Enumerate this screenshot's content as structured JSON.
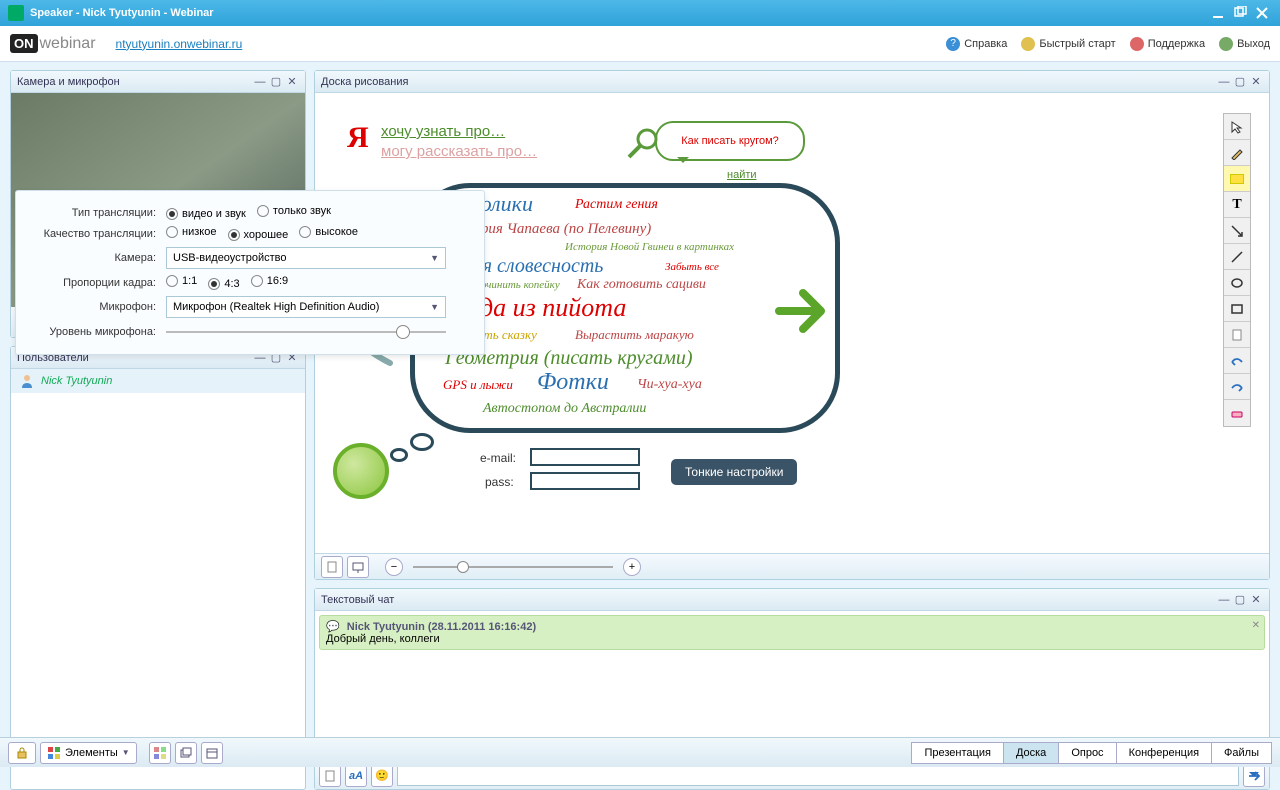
{
  "window": {
    "title": "Speaker - Nick Tyutyunin - Webinar"
  },
  "header": {
    "logo_on": "ON",
    "logo_web": "webinar",
    "url": "ntyutyunin.onwebinar.ru",
    "help": "Справка",
    "quickstart": "Быстрый старт",
    "support": "Поддержка",
    "logout": "Выход"
  },
  "camera_panel": {
    "title": "Камера и микрофон"
  },
  "settings": {
    "broadcast_type_label": "Тип трансляции:",
    "video_audio": "видео и звук",
    "audio_only": "только звук",
    "quality_label": "Качество трансляции:",
    "low": "низкое",
    "medium": "хорошее",
    "high": "высокое",
    "camera_label": "Камера:",
    "camera_value": "USB-видеоустройство",
    "aspect_label": "Пропорции кадра:",
    "a11": "1:1",
    "a43": "4:3",
    "a169": "16:9",
    "mic_label": "Микрофон:",
    "mic_value": "Микрофон (Realtek High Definition Audio)",
    "mic_level_label": "Уровень микрофона:"
  },
  "users_panel": {
    "title": "Пользователи",
    "user1": "Nick Tyutyunin"
  },
  "board_panel": {
    "title": "Доска рисования",
    "want": "хочу узнать про…",
    "can": "могу рассказать про…",
    "speech": "Как писать кругом?",
    "find": "найти",
    "tags": {
      "t1": "Кролики",
      "t2": "Растим гения",
      "t3": "Биография Чапаева (по Пелевину)",
      "t4": "История Новой Гвинеи в картинках",
      "t5": "Русская словесность",
      "t6": "Забыть все",
      "t7": "Починить копейку",
      "t8": "Как готовить сациви",
      "t9": "Блюда из пийота",
      "t10": "Как написать сказку",
      "t11": "Вырастить маракую",
      "t12": "Геометрия (писать кругами)",
      "t13": "GPS и лыжи",
      "t14": "Фотки",
      "t15": "Чи-хуа-хуа",
      "t16": "Автостопом до Австралии"
    },
    "email_label": "e-mail:",
    "pass_label": "pass:",
    "dark_btn": "Тонкие настройки"
  },
  "chat_panel": {
    "title": "Текстовый чат",
    "msg_meta": "Nick Tyutyunin (28.11.2011 16:16:42)",
    "msg_text": "Добрый день, коллеги"
  },
  "bottom": {
    "elements": "Элементы",
    "tab_presentation": "Презентация",
    "tab_board": "Доска",
    "tab_poll": "Опрос",
    "tab_conference": "Конференция",
    "tab_files": "Файлы"
  }
}
